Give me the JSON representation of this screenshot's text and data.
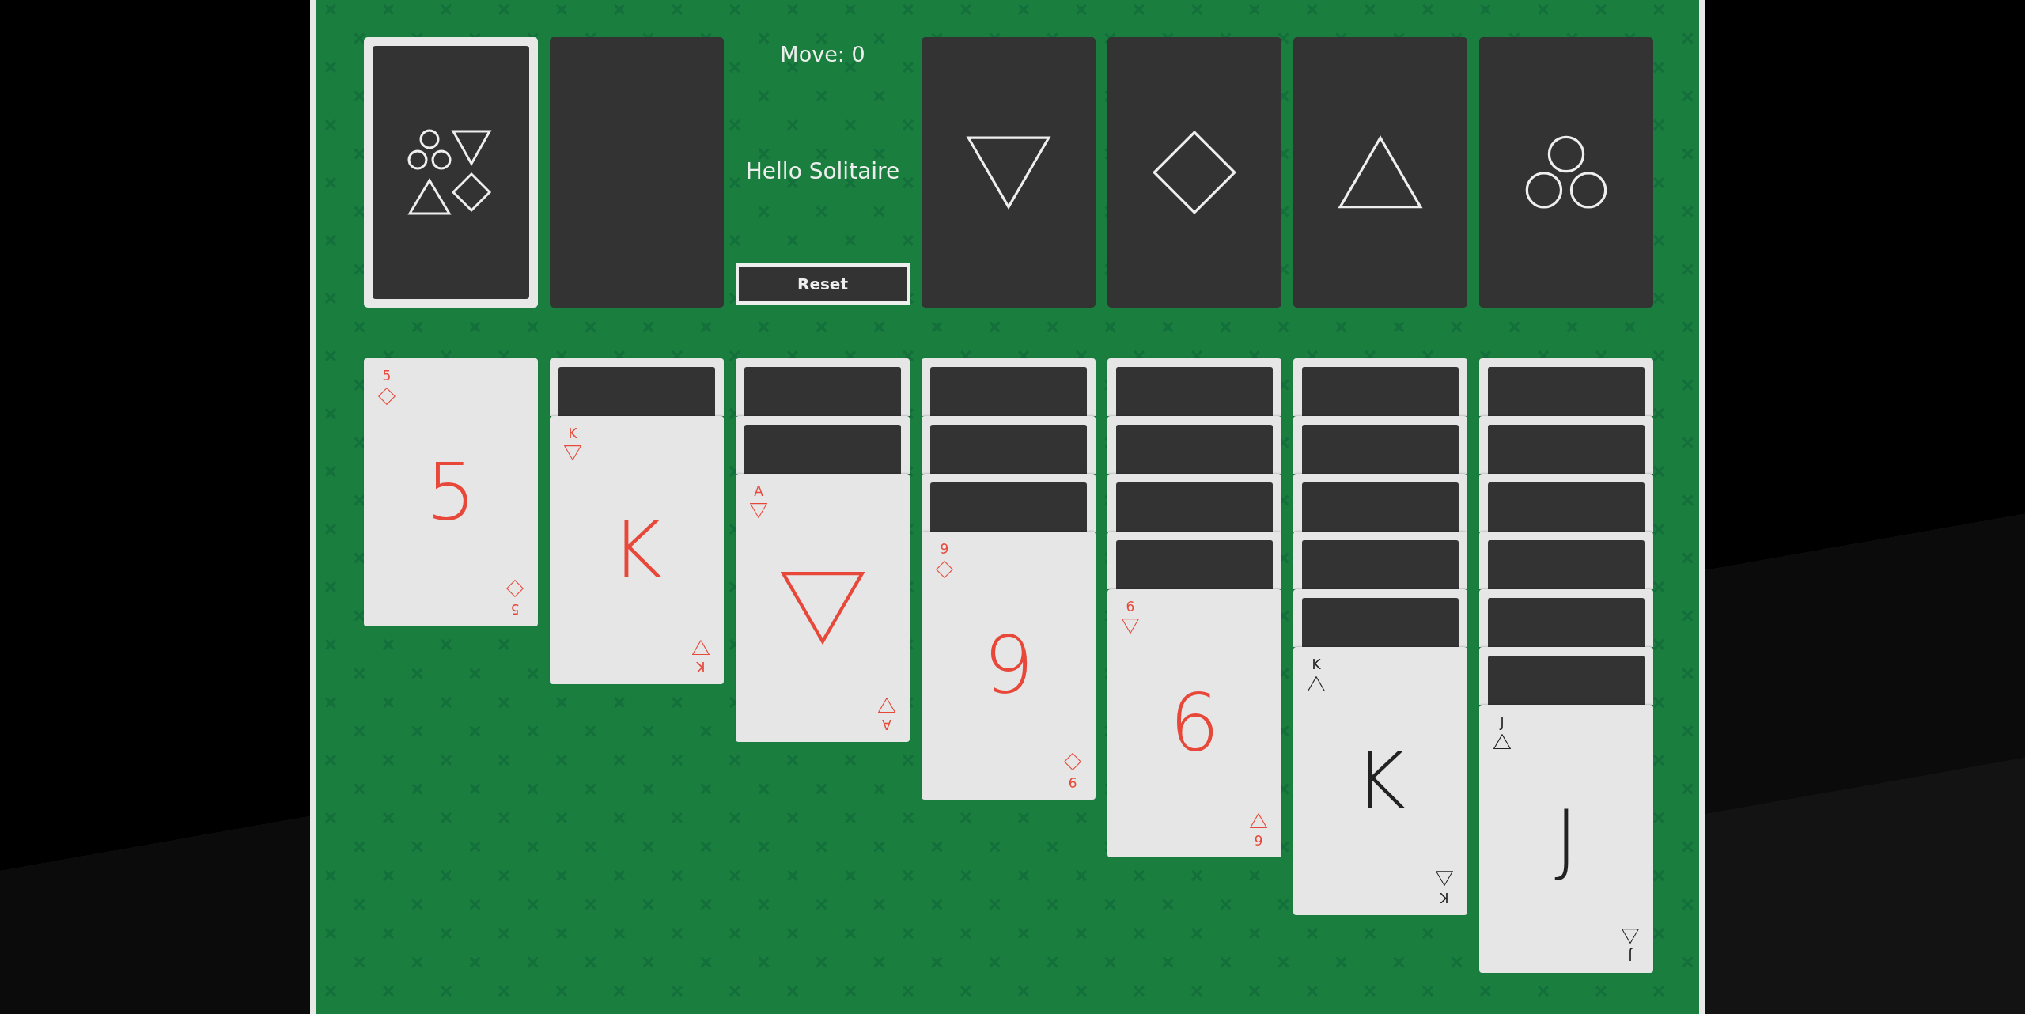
{
  "stock": {
    "has_cards": true
  },
  "waste": {
    "has_cards": false
  },
  "move_counter": "Move: 0",
  "title": "Hello Solitaire",
  "reset_button": "Reset",
  "foundations": [
    {
      "kind": "down_triangle"
    },
    {
      "kind": "diamond"
    },
    {
      "kind": "up_triangle"
    },
    {
      "kind": "circles"
    }
  ],
  "tableau": [
    {
      "cards": [
        {
          "face_up": true,
          "corner_top": {
            "rank": "5",
            "kind": "diamond"
          },
          "center": {
            "rank": "5"
          },
          "corner_bottom": {
            "rank": "5",
            "kind": "diamond"
          }
        }
      ]
    },
    {
      "cards": [
        {
          "face_up": false
        },
        {
          "face_up": true,
          "corner_top": {
            "rank": "K",
            "kind": "down_triangle"
          },
          "center": {
            "rank": "K"
          },
          "corner_bottom": {
            "rank": "K",
            "kind": "up_triangle"
          }
        }
      ]
    },
    {
      "cards": [
        {
          "face_up": false
        },
        {
          "face_up": false
        },
        {
          "face_up": true,
          "corner_top": {
            "rank": "A",
            "kind": "down_triangle"
          },
          "center": {
            "kind": "down_triangle"
          },
          "corner_bottom": {
            "rank": "A",
            "kind": "up_triangle"
          }
        }
      ]
    },
    {
      "cards": [
        {
          "face_up": false
        },
        {
          "face_up": false
        },
        {
          "face_up": false
        },
        {
          "face_up": true,
          "corner_top": {
            "rank": "9",
            "kind": "diamond"
          },
          "center": {
            "rank": "9"
          },
          "corner_bottom": {
            "rank": "9",
            "kind": "diamond"
          }
        }
      ]
    },
    {
      "cards": [
        {
          "face_up": false
        },
        {
          "face_up": false
        },
        {
          "face_up": false
        },
        {
          "face_up": false
        },
        {
          "face_up": true,
          "corner_top": {
            "rank": "6",
            "kind": "down_triangle"
          },
          "center": {
            "rank": "6"
          },
          "corner_bottom": {
            "rank": "6",
            "kind": "up_triangle"
          }
        }
      ]
    },
    {
      "cards": [
        {
          "face_up": false
        },
        {
          "face_up": false
        },
        {
          "face_up": false
        },
        {
          "face_up": false
        },
        {
          "face_up": false
        },
        {
          "face_up": true,
          "corner_top": {
            "rank": "K",
            "kind": "up_triangle"
          },
          "center": {
            "rank": "K"
          },
          "corner_bottom": {
            "rank": "K",
            "kind": "down_triangle"
          }
        }
      ]
    },
    {
      "cards": [
        {
          "face_up": false
        },
        {
          "face_up": false
        },
        {
          "face_up": false
        },
        {
          "face_up": false
        },
        {
          "face_up": false
        },
        {
          "face_up": false
        },
        {
          "face_up": true,
          "corner_top": {
            "rank": "J",
            "kind": "up_triangle"
          },
          "center": {
            "rank": "J"
          },
          "corner_bottom": {
            "rank": "J",
            "kind": "down_triangle"
          }
        }
      ]
    }
  ]
}
